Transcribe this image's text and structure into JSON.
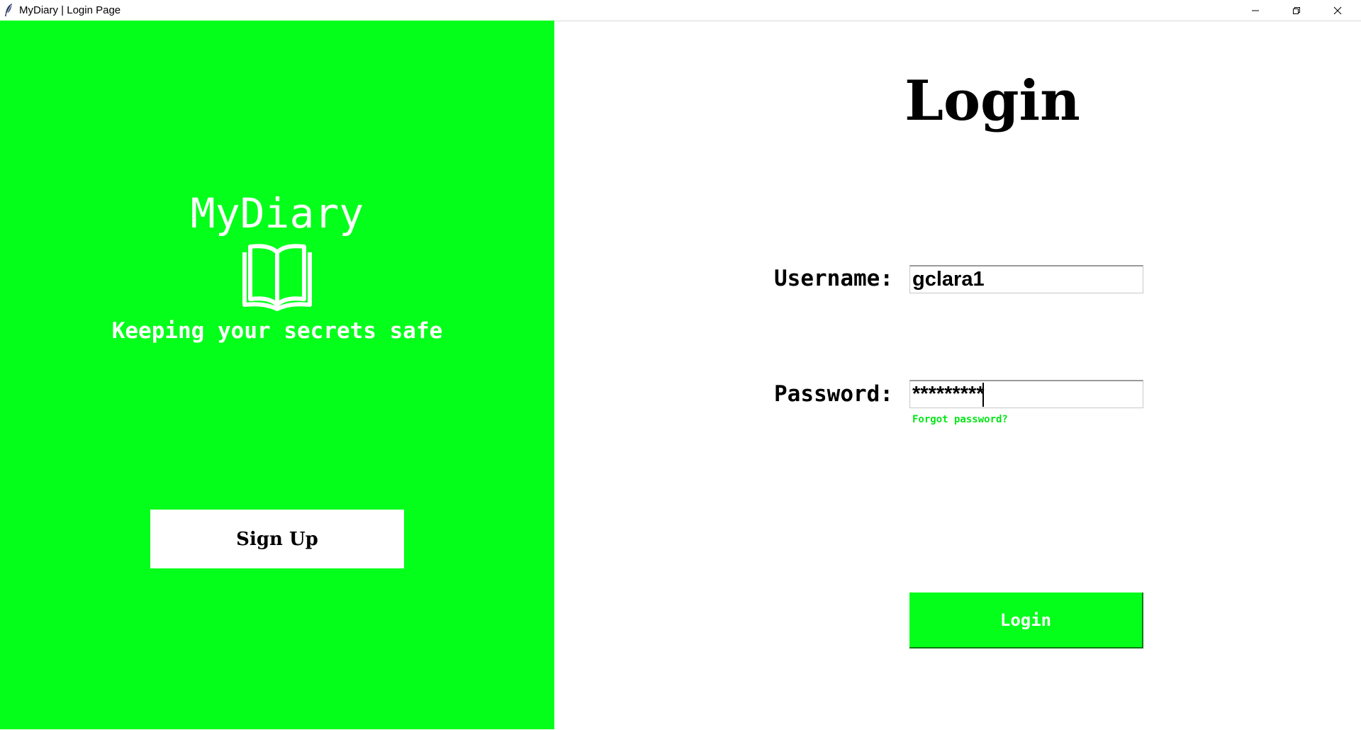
{
  "window": {
    "title": "MyDiary | Login Page",
    "controls": {
      "minimize_icon": "minimize-icon",
      "maximize_icon": "restore-icon",
      "close_icon": "close-icon"
    }
  },
  "colors": {
    "accent": "#03ff1a",
    "panel_text": "#ffffff",
    "link": "#03e617"
  },
  "left_panel": {
    "brand_title": "MyDiary",
    "brand_icon": "open-book-icon",
    "tagline": "Keeping your secrets safe",
    "signup_label": "Sign Up"
  },
  "login_form": {
    "heading": "Login",
    "username_label": "Username:",
    "username_value": "gclara1",
    "password_label": "Password:",
    "password_value": "*********",
    "forgot_label": "Forgot password?",
    "login_label": "Login"
  }
}
